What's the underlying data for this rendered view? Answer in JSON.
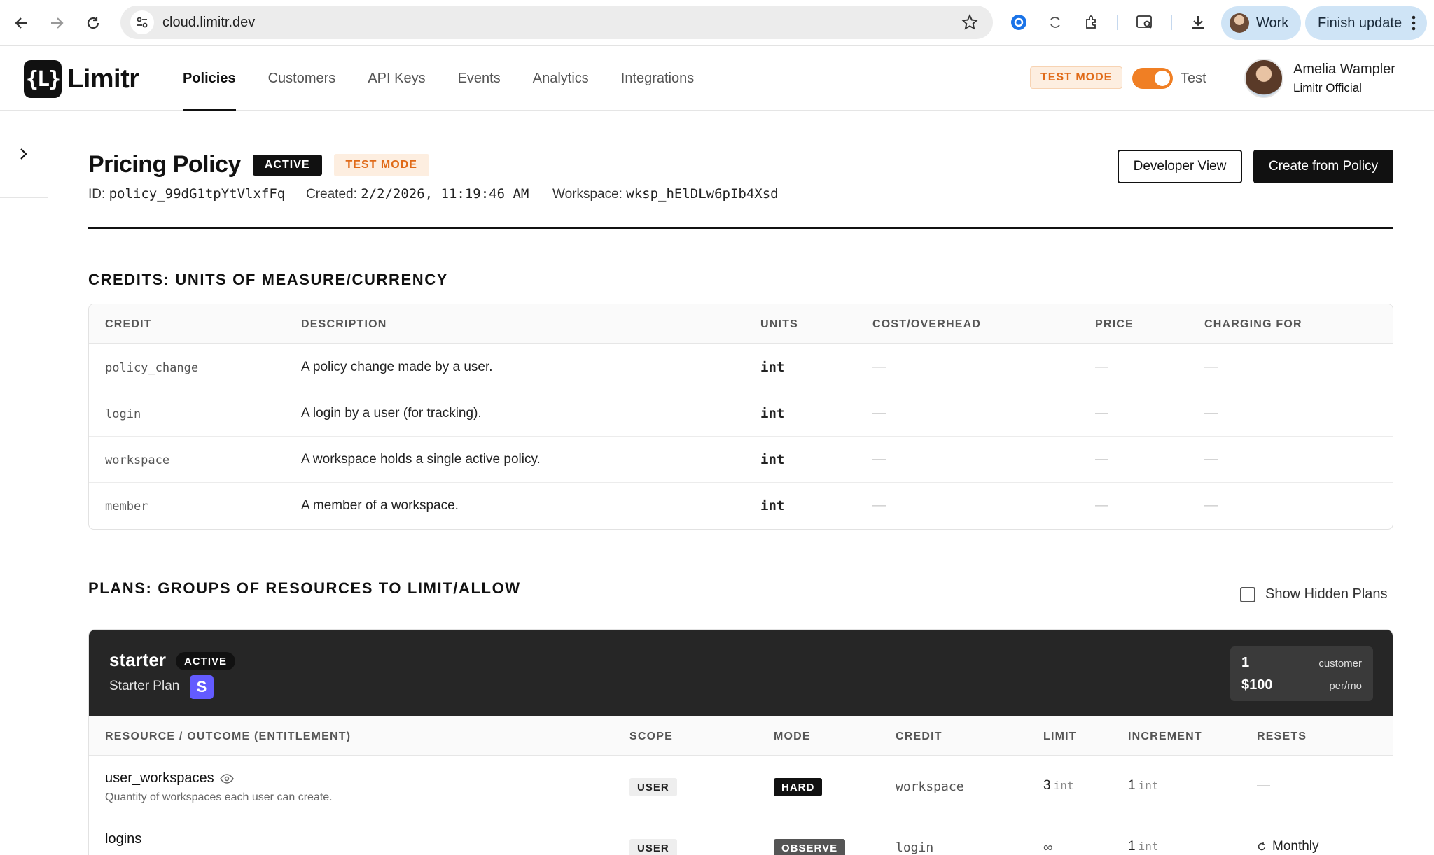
{
  "browser": {
    "url": "cloud.limitr.dev",
    "profile_label": "Work",
    "update_label": "Finish update"
  },
  "app": {
    "logo_mark": "{L}",
    "logo_text": "Limitr",
    "nav": [
      "Policies",
      "Customers",
      "API Keys",
      "Events",
      "Analytics",
      "Integrations"
    ],
    "active_nav": "Policies",
    "test_mode_badge": "TEST MODE",
    "toggle_label": "Test",
    "user": {
      "name": "Amelia Wampler",
      "org": "Limitr Official"
    }
  },
  "policy": {
    "title": "Pricing Policy",
    "status": "ACTIVE",
    "mode": "TEST MODE",
    "id_label": "ID:",
    "id_value": "policy_99dG1tpYtVlxfFq",
    "created_label": "Created:",
    "created_value": "2/2/2026, 11:19:46 AM",
    "workspace_label": "Workspace:",
    "workspace_value": "wksp_hElDLw6pIb4Xsd",
    "developer_view_label": "Developer View",
    "create_from_label": "Create from Policy"
  },
  "credits": {
    "title": "CREDITS: UNITS OF MEASURE/CURRENCY",
    "columns": [
      "CREDIT",
      "DESCRIPTION",
      "UNITS",
      "COST/OVERHEAD",
      "PRICE",
      "CHARGING FOR"
    ],
    "rows": [
      {
        "credit": "policy_change",
        "description": "A policy change made by a user.",
        "units": "int",
        "cost": "—",
        "price": "—",
        "charging": "—"
      },
      {
        "credit": "login",
        "description": "A login by a user (for tracking).",
        "units": "int",
        "cost": "—",
        "price": "—",
        "charging": "—"
      },
      {
        "credit": "workspace",
        "description": "A workspace holds a single active policy.",
        "units": "int",
        "cost": "—",
        "price": "—",
        "charging": "—"
      },
      {
        "credit": "member",
        "description": "A member of a workspace.",
        "units": "int",
        "cost": "—",
        "price": "—",
        "charging": "—"
      }
    ]
  },
  "plans": {
    "title": "PLANS: GROUPS OF RESOURCES TO LIMIT/ALLOW",
    "show_hidden_label": "Show Hidden Plans",
    "items": [
      {
        "name": "starter",
        "status": "ACTIVE",
        "display_name": "Starter Plan",
        "stripe_letter": "S",
        "quantity": "1",
        "quantity_unit": "customer",
        "price": "$100",
        "price_unit": "per/mo",
        "columns": [
          "RESOURCE / OUTCOME (ENTITLEMENT)",
          "SCOPE",
          "MODE",
          "CREDIT",
          "LIMIT",
          "INCREMENT",
          "RESETS"
        ],
        "rows": [
          {
            "name": "user_workspaces",
            "description": "Quantity of workspaces each user can create.",
            "scope": "USER",
            "mode": "HARD",
            "credit": "workspace",
            "limit": "3",
            "limit_unit": "int",
            "increment": "1",
            "increment_unit": "int",
            "resets": "—"
          },
          {
            "name": "logins",
            "description": "",
            "scope": "USER",
            "mode": "OBSERVE",
            "credit": "login",
            "limit": "∞",
            "limit_unit": "",
            "increment": "1",
            "increment_unit": "int",
            "resets": "Monthly"
          }
        ]
      }
    ]
  }
}
